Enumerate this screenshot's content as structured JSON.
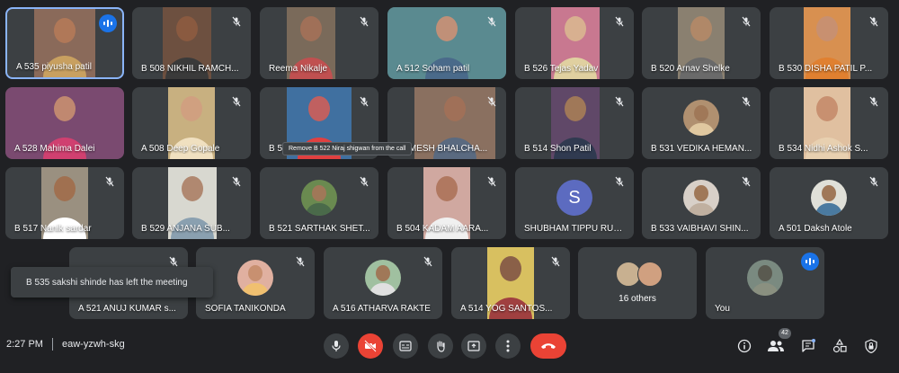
{
  "participants": [
    {
      "name": "A 535 piyusha patil",
      "status": "speaking"
    },
    {
      "name": "B 508 NIKHIL RAMCH...",
      "status": "muted"
    },
    {
      "name": "Reema Nikalje",
      "status": "muted"
    },
    {
      "name": "A 512 Soham patil",
      "status": "muted"
    },
    {
      "name": "B 526 Tejas Yadav",
      "status": "muted"
    },
    {
      "name": "B 520 Arnav Shelke",
      "status": "muted"
    },
    {
      "name": "B 530 DISHA PATIL P...",
      "status": "muted"
    },
    {
      "name": "A 528 Mahima Dalei",
      "status": "unmuted"
    },
    {
      "name": "A 508 Deep Gopale",
      "status": "muted"
    },
    {
      "name": "B 5...",
      "status": "muted"
    },
    {
      "name": "RAMESH BHALCHA...",
      "status": "muted"
    },
    {
      "name": "B 514 Shon Patil",
      "status": "muted"
    },
    {
      "name": "B 531 VEDIKA HEMAN...",
      "status": "muted"
    },
    {
      "name": "B 534 Nidhi Ashok S...",
      "status": "muted"
    },
    {
      "name": "B 517 Nanik sardar",
      "status": "muted"
    },
    {
      "name": "B 529 ANJANA SUB...",
      "status": "muted"
    },
    {
      "name": "B 521 SARTHAK SHET...",
      "status": "muted"
    },
    {
      "name": "B 504 KADAM AARA...",
      "status": "muted"
    },
    {
      "name": "SHUBHAM TIPPU RUK...",
      "status": "muted",
      "initial": "S"
    },
    {
      "name": "B 533 VAIBHAVI SHIN...",
      "status": "muted"
    },
    {
      "name": "A 501 Daksh Atole",
      "status": "muted"
    },
    {
      "name": "A 521 ANUJ KUMAR s...",
      "status": "muted"
    },
    {
      "name": "SOFIA TANIKONDA",
      "status": "muted"
    },
    {
      "name": "A 516 ATHARVA RAKTE",
      "status": "muted"
    },
    {
      "name": "A 514 YOG SANTOS...",
      "status": "muted"
    },
    {
      "name": "You",
      "status": "speaking"
    }
  ],
  "others_tile": {
    "label": "16 others"
  },
  "tooltip": {
    "text": "Remove B 522 Niraj shigwan from the call"
  },
  "toast": {
    "text": "B 535 sakshi shinde has left the meeting"
  },
  "footer": {
    "time": "2:27 PM",
    "separator": "|",
    "meeting_code": "eaw-yzwh-skg",
    "people_count": "42"
  },
  "controls": {
    "mic": "mic-icon",
    "camera": "camera-off-icon",
    "captions": "captions-icon",
    "raise_hand": "hand-icon",
    "present": "present-icon",
    "more": "more-options-icon",
    "leave": "leave-call-icon"
  },
  "colors": {
    "background": "#202124",
    "tile": "#3c4043",
    "speaking_blue": "#1a73e8",
    "leave_red": "#ea4335",
    "avatar_s": "#5c6bc0"
  }
}
